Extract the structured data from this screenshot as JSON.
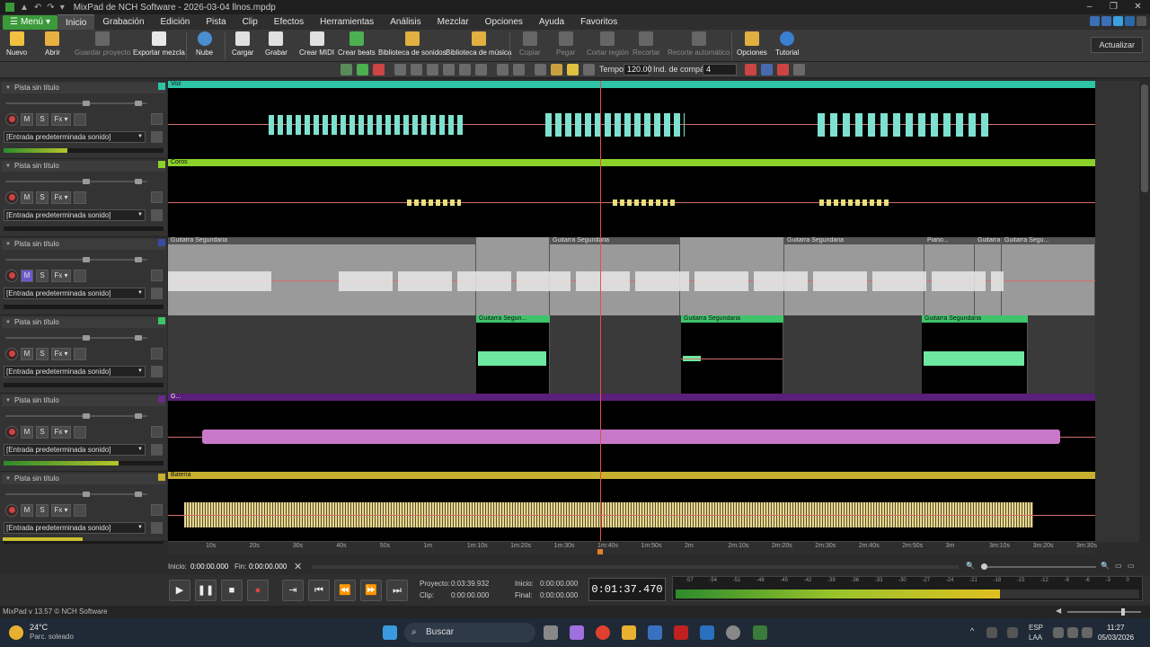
{
  "titlebar": {
    "title": "MixPad de NCH Software - 2026-03-04 llnos.mpdp",
    "quick": [
      "▪",
      "▲",
      "↶",
      "↷",
      "▾"
    ],
    "controls": [
      "–",
      "❐",
      "✕"
    ]
  },
  "menubar": {
    "menu_label": "Menú",
    "items": [
      "Inicio",
      "Grabación",
      "Edición",
      "Pista",
      "Clip",
      "Efectos",
      "Herramientas",
      "Análisis",
      "Mezclar",
      "Opciones",
      "Ayuda",
      "Favoritos"
    ],
    "active": "Inicio"
  },
  "toolbar": {
    "buttons": [
      {
        "label": "Nuevo",
        "icon": "new-icon",
        "color": "#f0c040",
        "enabled": true
      },
      {
        "label": "Abrir",
        "icon": "folder-icon",
        "color": "#e8b040",
        "enabled": true
      },
      {
        "label": "Guardar proyecto",
        "icon": "save-icon",
        "color": "#888",
        "enabled": false
      },
      {
        "label": "Exportar mezcla",
        "icon": "export-icon",
        "color": "#e8e8e8",
        "enabled": true
      },
      {
        "label": "Nube",
        "icon": "cloud-icon",
        "color": "#4a8ed0",
        "enabled": true
      },
      {
        "label": "Cargar",
        "icon": "load-icon",
        "color": "#e0e0e0",
        "enabled": true
      },
      {
        "label": "Grabar",
        "icon": "record-file-icon",
        "color": "#e0e0e0",
        "enabled": true
      },
      {
        "label": "Crear MIDI",
        "icon": "midi-icon",
        "color": "#e0e0e0",
        "enabled": true
      },
      {
        "label": "Crear beats",
        "icon": "beats-icon",
        "color": "#4caf50",
        "enabled": true
      },
      {
        "label": "Biblioteca de sonidos",
        "icon": "sound-library-icon",
        "color": "#e0b040",
        "enabled": true
      },
      {
        "label": "Biblioteca de música",
        "icon": "music-library-icon",
        "color": "#e0b040",
        "enabled": true
      },
      {
        "label": "Copiar",
        "icon": "copy-icon",
        "color": "#888",
        "enabled": false
      },
      {
        "label": "Pegar",
        "icon": "paste-icon",
        "color": "#888",
        "enabled": false
      },
      {
        "label": "Cortar región",
        "icon": "cut-region-icon",
        "color": "#888",
        "enabled": false
      },
      {
        "label": "Recortar",
        "icon": "trim-icon",
        "color": "#888",
        "enabled": false
      },
      {
        "label": "Recorte automático",
        "icon": "auto-trim-icon",
        "color": "#888",
        "enabled": false
      },
      {
        "label": "Opciones",
        "icon": "options-icon",
        "color": "#e0b040",
        "enabled": true
      },
      {
        "label": "Tutorial",
        "icon": "tutorial-icon",
        "color": "#3b7fd0",
        "enabled": true
      }
    ],
    "actualizar": "Actualizar"
  },
  "subtoolbar": {
    "tempo_label": "Tempo:",
    "tempo_value": "120.00",
    "compas_label": "Ind. de compás:",
    "compas_value": "4"
  },
  "tracks": [
    {
      "name": "Pista sin título",
      "color": "#2ec4a6",
      "input": "[Entrada predeterminada sonido]",
      "meter": 0.4,
      "clips": [
        {
          "label": "Voz",
          "color": "#2ec4a6"
        }
      ],
      "wave": "#7ee0cf"
    },
    {
      "name": "Pista sin título",
      "color": "#8bd12a",
      "input": "[Entrada predeterminada sonido]",
      "meter": 0.0,
      "clips": [
        {
          "label": "Coros",
          "color": "#8bd12a"
        }
      ],
      "wave": "#e8e07a"
    },
    {
      "name": "Pista sin título",
      "color": "#3a4aa0",
      "input": "[Entrada predeterminada sonido]",
      "meter": 0.0,
      "clips": [
        {
          "label": "Guitarra Segundaria"
        },
        {
          "label": "Guitarra Segundaria"
        },
        {
          "label": "Guitarra Segundaria"
        },
        {
          "label": "Piano..."
        },
        {
          "label": "Guitarra"
        },
        {
          "label": "Guitarra Segu..."
        }
      ],
      "wave": "#e8e8e8"
    },
    {
      "name": "Pista sin título",
      "color": "#3ec46a",
      "input": "[Entrada predeterminada sonido]",
      "meter": 0.0,
      "clips": [
        {
          "label": "Guitarra Segun..."
        },
        {
          "label": "Guitarra Segundaria"
        },
        {
          "label": "Guitarra Segundaria"
        }
      ],
      "wave": "#6ee8a0"
    },
    {
      "name": "Pista sin título",
      "color": "#6a2a8a",
      "input": "[Entrada predeterminada sonido]",
      "meter": 0.72,
      "clips": [
        {
          "label": "G...",
          "color": "#5a1f7a"
        }
      ],
      "wave": "#c878c8"
    },
    {
      "name": "Pista sin título",
      "color": "#c8b030",
      "input": "[Entrada predeterminada sonido]",
      "meter": 0.0,
      "clips": [
        {
          "label": "Batería",
          "color": "#c8b030"
        }
      ],
      "wave": "#e8d890"
    }
  ],
  "ruler": [
    "10s",
    "20s",
    "30s",
    "40s",
    "50s",
    "1m",
    "1m:10s",
    "1m:20s",
    "1m:30s",
    "1m:40s",
    "1m:50s",
    "2m",
    "2m:10s",
    "2m:20s",
    "2m:30s",
    "2m:40s",
    "2m:50s",
    "3m",
    "3m:10s",
    "3m:20s",
    "3m:30s"
  ],
  "range": {
    "inicio_label": "Inicio:",
    "inicio": "0:00:00.000",
    "fin_label": "Fin:",
    "fin": "0:00:00.000"
  },
  "transport": {
    "proyecto_label": "Proyecto:",
    "proyecto": "0:03:39.932",
    "clip_label": "Clip:",
    "clip": "0:00:00.000",
    "inicio_label": "Inicio:",
    "inicio": "0:00:00.000",
    "final_label": "Final:",
    "final": "0:00:00.000",
    "time": "0:01:37.470",
    "vu_ticks": [
      "-57",
      "-54",
      "-51",
      "-48",
      "-45",
      "-42",
      "-39",
      "-36",
      "-33",
      "-30",
      "-27",
      "-24",
      "-21",
      "-18",
      "-15",
      "-12",
      "-9",
      "-6",
      "-3",
      "0"
    ],
    "vu_level": 0.7
  },
  "status": {
    "version": "MixPad v 13.57 © NCH Software"
  },
  "taskbar": {
    "weather_temp": "24°C",
    "weather_desc": "Parc. soleado",
    "search": "Buscar",
    "lang": "ESP",
    "lang2": "LAA",
    "time": "11:27",
    "date": "05/03/2026"
  }
}
